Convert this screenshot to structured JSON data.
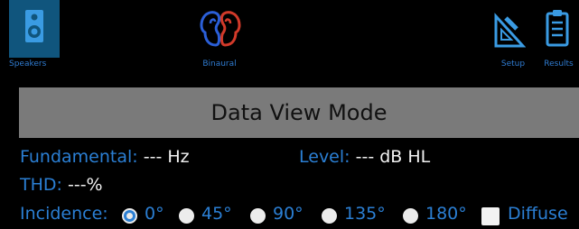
{
  "toolbar": {
    "speakers_label": "Speakers",
    "binaural_label": "Binaural",
    "setup_label": "Setup",
    "results_label": "Results"
  },
  "banner": {
    "title": "Data View Mode"
  },
  "readouts": {
    "fundamental_label": "Fundamental:",
    "fundamental_value": "--- Hz",
    "level_label": "Level:",
    "level_value": "--- dB HL",
    "thd_label": "THD:",
    "thd_value": "---%"
  },
  "incidence": {
    "label": "Incidence:",
    "options": [
      "0°",
      "45°",
      "90°",
      "135°",
      "180°"
    ],
    "selected": "0°",
    "diffuse_label": "Diffuse",
    "diffuse_checked": false
  },
  "colors": {
    "accent": "#2b7fd4",
    "selected_tool_bg": "#10557d",
    "banner_bg": "#7a7a7a"
  }
}
